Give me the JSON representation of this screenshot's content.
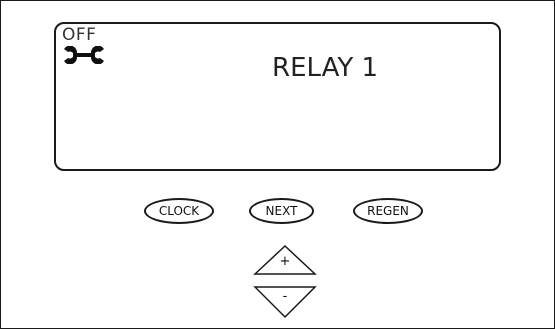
{
  "display": {
    "status": "OFF",
    "status_icon": "wrench-icon",
    "label": "RELAY 1"
  },
  "buttons": {
    "clock": "CLOCK",
    "next": "NEXT",
    "regen": "REGEN"
  },
  "arrows": {
    "up_label": "+",
    "down_label": "-",
    "up_icon": "triangle-up-icon",
    "down_icon": "triangle-down-icon"
  }
}
